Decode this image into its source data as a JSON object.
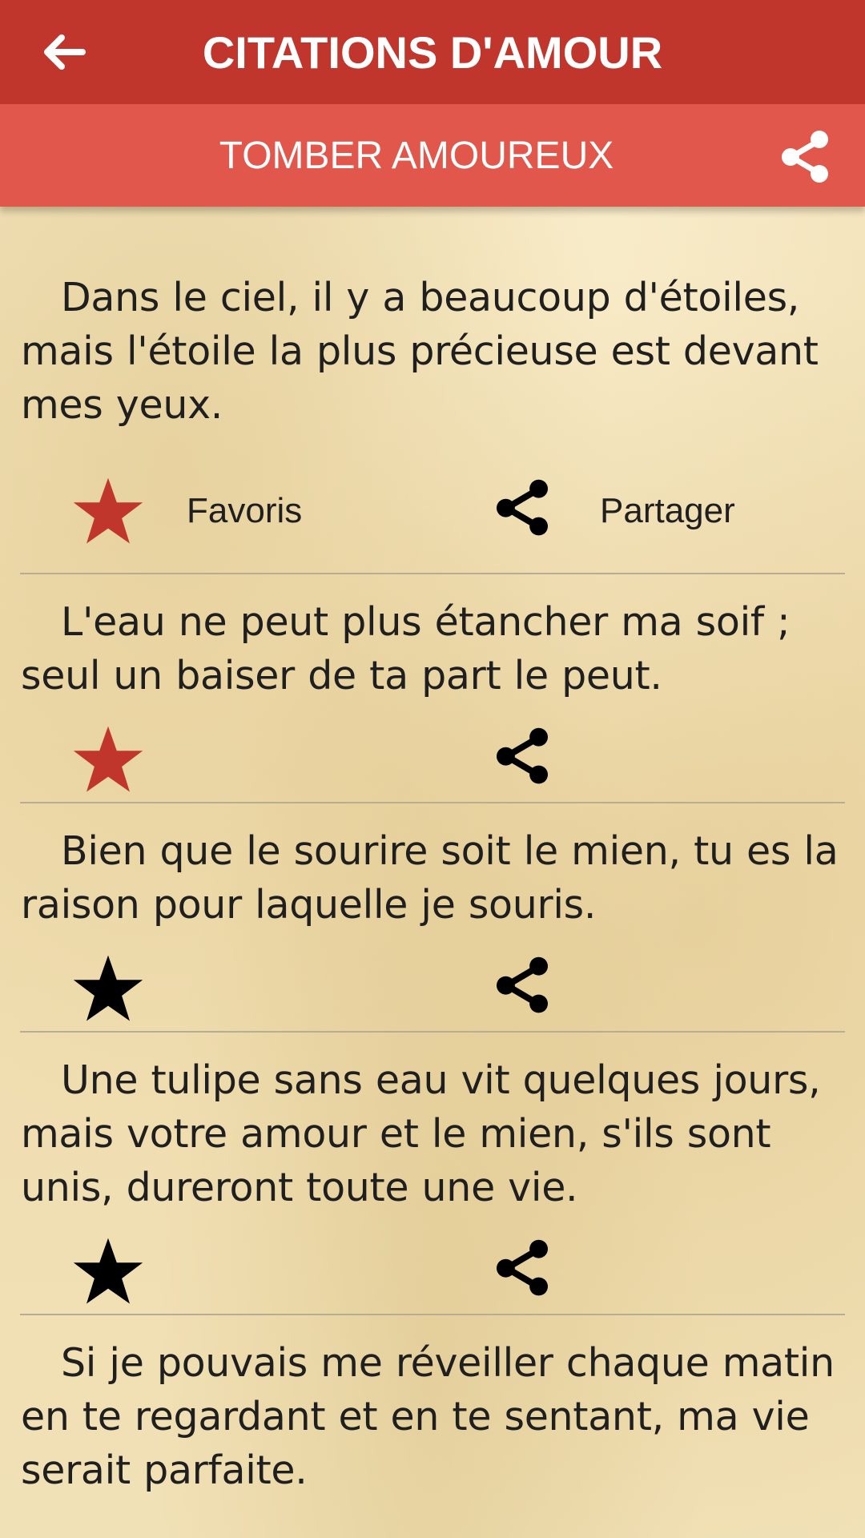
{
  "header": {
    "title": "CITATIONS D'AMOUR",
    "back_icon": "arrow-left-icon"
  },
  "subheader": {
    "category": "TOMBER AMOUREUX",
    "share_icon": "share-icon"
  },
  "colors": {
    "topbar": "#c0362c",
    "subbar": "#e1574b",
    "favorite_active": "#c0362c",
    "favorite_inactive": "#000000",
    "paper": "#f2e3ba"
  },
  "quotes": [
    {
      "text": "Dans le ciel, il y a beaucoup d'étoiles, mais l'étoile la plus précieuse est devant mes yeux.",
      "favorite": true,
      "favorite_label": "Favoris",
      "share_label": "Partager"
    },
    {
      "text": "L'eau ne peut plus étancher ma soif ; seul un baiser de ta part le peut.",
      "favorite": true
    },
    {
      "text": "Bien que le sourire soit le mien, tu es la raison pour laquelle je souris.",
      "favorite": false
    },
    {
      "text": "Une tulipe sans eau vit quelques jours, mais votre amour et le mien, s'ils sont unis, dureront toute une vie.",
      "favorite": false
    },
    {
      "text": "Si je pouvais me réveiller chaque matin en te regardant et en te sentant, ma vie serait parfaite.",
      "favorite": false
    }
  ]
}
